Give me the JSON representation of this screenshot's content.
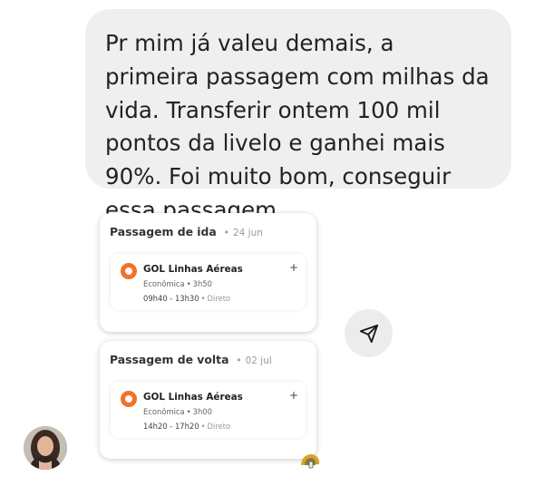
{
  "message": {
    "text": "Pr mim já valeu demais, a primeira passagem com milhas da vida. Transferir ontem 100 mil pontos da livelo e ganhei mais 90%. Foi muito bom, conseguir essa passagem."
  },
  "cards": [
    {
      "title": "Passagem de ida",
      "date": "24 jun",
      "airline": "GOL Linhas Aéreas",
      "cabin": "Econômica",
      "duration": "3h50",
      "times": "09h40 - 13h30",
      "stops": "Direto"
    },
    {
      "title": "Passagem de volta",
      "date": "02 jul",
      "airline": "GOL Linhas Aéreas",
      "cabin": "Econômica",
      "duration": "3h00",
      "times": "14h20 - 17h20",
      "stops": "Direto"
    }
  ],
  "icons": {
    "share": "send-icon",
    "airline": "gol-logo-icon",
    "expand": "plus-icon",
    "sticker": "reaction-sticker-icon"
  },
  "colors": {
    "bubble_bg": "#efefef",
    "airline_orange": "#f0722b"
  }
}
